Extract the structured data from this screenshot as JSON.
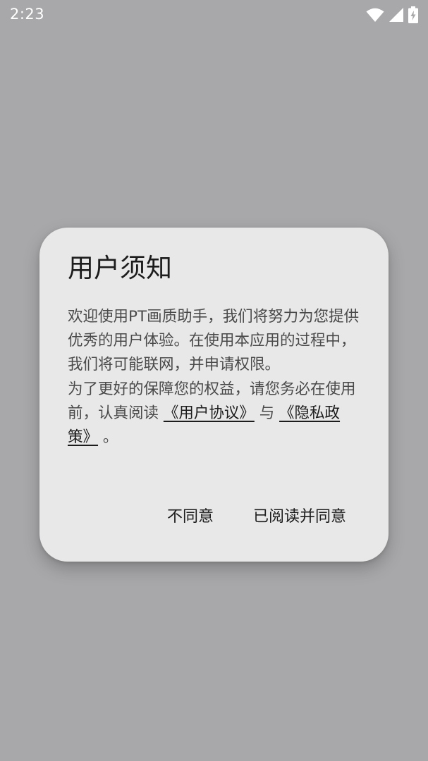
{
  "status_bar": {
    "time": "2:23",
    "icons": [
      "wifi-icon",
      "cell-signal-icon",
      "battery-charging-icon"
    ]
  },
  "dialog": {
    "title": "用户须知",
    "paragraph1": "欢迎使用PT画质助手，我们将努力为您提供优秀的用户体验。在使用本应用的过程中，我们将可能联网，并申请权限。",
    "paragraph2_prefix": "为了更好的保障您的权益，请您务必在使用前，认真阅读 ",
    "user_agreement_link": "《用户协议》",
    "paragraph2_middle": " 与 ",
    "privacy_policy_link": "《隐私政策》",
    "paragraph2_suffix": " 。",
    "disagree_label": "不同意",
    "agree_label": "已阅读并同意"
  },
  "colors": {
    "overlay_background": "#a8a8aa",
    "dialog_background": "#e8e8e8",
    "title_text": "#1c1c1c",
    "body_text": "#4a4a4a"
  }
}
